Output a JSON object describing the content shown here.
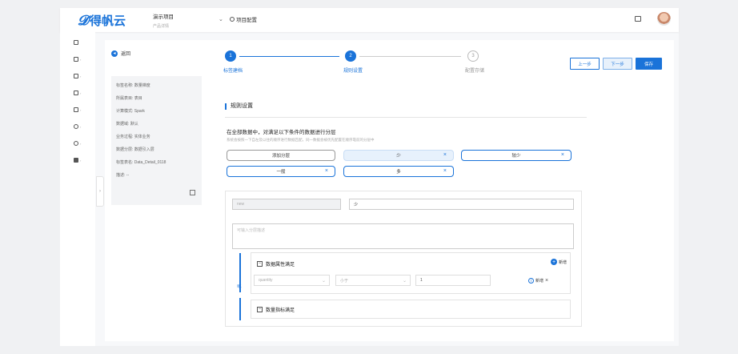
{
  "app": {
    "brand": "得帆云",
    "project_name": "演示项目",
    "project_sub": "产品详情",
    "config_label": "项目配置"
  },
  "nav": {
    "icons": [
      "home-icon",
      "data-icon",
      "model-icon",
      "table-icon",
      "service-icon",
      "globe-icon",
      "settings-icon",
      "chart-icon"
    ]
  },
  "back": {
    "label": "返回"
  },
  "info": {
    "rows": [
      {
        "label": "标签名称:",
        "value": "数量梯度"
      },
      {
        "label": "所属表目:",
        "value": "表目"
      },
      {
        "label": "计算模式:",
        "value": "Spark"
      },
      {
        "label": "数据域:",
        "value": "默认"
      },
      {
        "label": "业务过程:",
        "value": "实体业务"
      },
      {
        "label": "数据分层:",
        "value": "数据引入层"
      },
      {
        "label": "标签表名:",
        "value": "Data_Detail_0118"
      },
      {
        "label": "描述:",
        "value": "--"
      }
    ]
  },
  "steps": [
    {
      "num": "1",
      "label": "标签建档",
      "state": "done"
    },
    {
      "num": "2",
      "label": "规则设置",
      "state": "active"
    },
    {
      "num": "3",
      "label": "配置存储",
      "state": "idle"
    }
  ],
  "buttons": {
    "prev": "上一步",
    "next": "下一步",
    "save": "保存"
  },
  "section": {
    "title": "规则设置"
  },
  "rule": {
    "desc": "在全部数据中，对满足以下条件的数据进行分层",
    "hint": "系统会按照一下自左及以往的顺序进行数据匹配，同一数据会被优先配置在顺序靠前的分层中",
    "tags": [
      {
        "label": "添加分层",
        "style": "default"
      },
      {
        "label": "少",
        "style": "selected"
      },
      {
        "label": "较少",
        "style": "blue"
      },
      {
        "label": "一般",
        "style": "blue"
      },
      {
        "label": "多",
        "style": "blue"
      }
    ]
  },
  "editor": {
    "code_value": "new",
    "name_value": "少",
    "desc_placeholder": "可输入分层描述",
    "or_label": "或",
    "cond1": {
      "title": "数据属性满足",
      "add_label": "新增",
      "field": "quantity",
      "op": "小于",
      "value": "1",
      "row_add": "新增"
    },
    "cond2": {
      "title": "数量指标满足"
    }
  }
}
